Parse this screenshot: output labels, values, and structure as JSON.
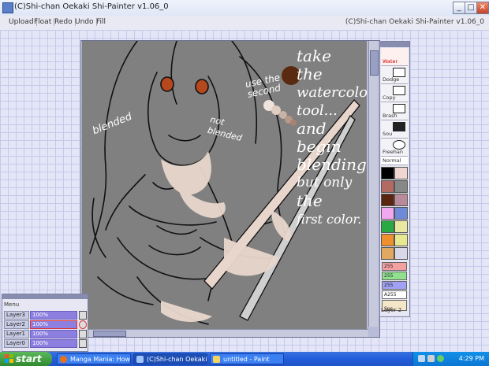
{
  "window": {
    "title": "(C)Shi-chan Oekaki Shi-Painter v1.06_0"
  },
  "menu": {
    "items": [
      "Upload",
      "Float",
      "Redo",
      "Undo",
      "Fill"
    ],
    "right_title": "(C)Shi-chan Oekaki Shi-Painter v1.06_0"
  },
  "canvas": {
    "annotations": {
      "blended": "blended",
      "not_blended": "not blended",
      "use_the_second": "use the second",
      "instruction": [
        "take",
        "the",
        "watercolor",
        "tool...",
        "and begin",
        "blending,",
        "but only",
        "the",
        "first color."
      ]
    },
    "colors": {
      "background": "#808080",
      "dot_dark": "#5a2a10",
      "dot_light": "#f3e8e2"
    }
  },
  "tools": [
    {
      "label": "Water"
    },
    {
      "label": "Dodge"
    },
    {
      "label": "Copy"
    },
    {
      "label": "Brash"
    },
    {
      "label": "Sou"
    },
    {
      "label": "Freehan"
    }
  ],
  "tool_mode": "Normal",
  "palette": [
    "#000000",
    "#f0d6d0",
    "#b26a62",
    "#888888",
    "#5a2410",
    "#b98a9a",
    "#f0a8f0",
    "#6f8ad8",
    "#2aa844",
    "#e8e8a0",
    "#ee9030",
    "#e8e890",
    "#e0a860",
    "#d8d8e8"
  ],
  "sliders": [
    "255",
    "255",
    "255",
    "A255"
  ],
  "sizes": {
    "label": "Spc"
  },
  "current_layer": "Layer 2",
  "layers": {
    "menu": "Menu",
    "rows": [
      {
        "name": "Layer3",
        "opacity": "100%"
      },
      {
        "name": "Layer2",
        "opacity": "100%"
      },
      {
        "name": "Layer1",
        "opacity": "100%"
      },
      {
        "name": "Layer0",
        "opacity": "100%"
      }
    ]
  },
  "taskbar": {
    "start": "start",
    "buttons": [
      {
        "label": "Manga Mania: How to..."
      },
      {
        "label": "(C)Shi-chan Oekaki S..."
      },
      {
        "label": "untitled - Paint"
      }
    ],
    "clock": "4:29 PM"
  }
}
